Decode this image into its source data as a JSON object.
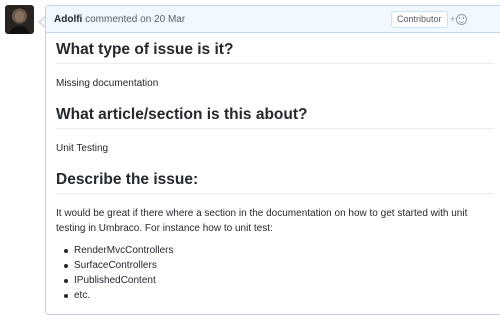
{
  "comment": {
    "author": "Adolfi",
    "action": "commented on",
    "date": "20 Mar",
    "role_badge": "Contributor",
    "reaction_button": "+",
    "reaction_icon": "smiley-icon"
  },
  "body": {
    "heading_type": "What type of issue is it?",
    "text_type": "Missing documentation",
    "heading_article": "What article/section is this about?",
    "text_article": "Unit Testing",
    "heading_describe": "Describe the issue:",
    "text_describe": "It would be great if there where a section in the documentation on how to get started with unit testing in Umbraco. For instance how to unit test:",
    "list": [
      "RenderMvcControllers",
      "SurfaceControllers",
      "IPublishedContent",
      "etc."
    ]
  },
  "colors": {
    "header_bg": "#f1f8ff",
    "border": "#c0d3eb",
    "text": "#24292e",
    "muted": "#586069"
  }
}
